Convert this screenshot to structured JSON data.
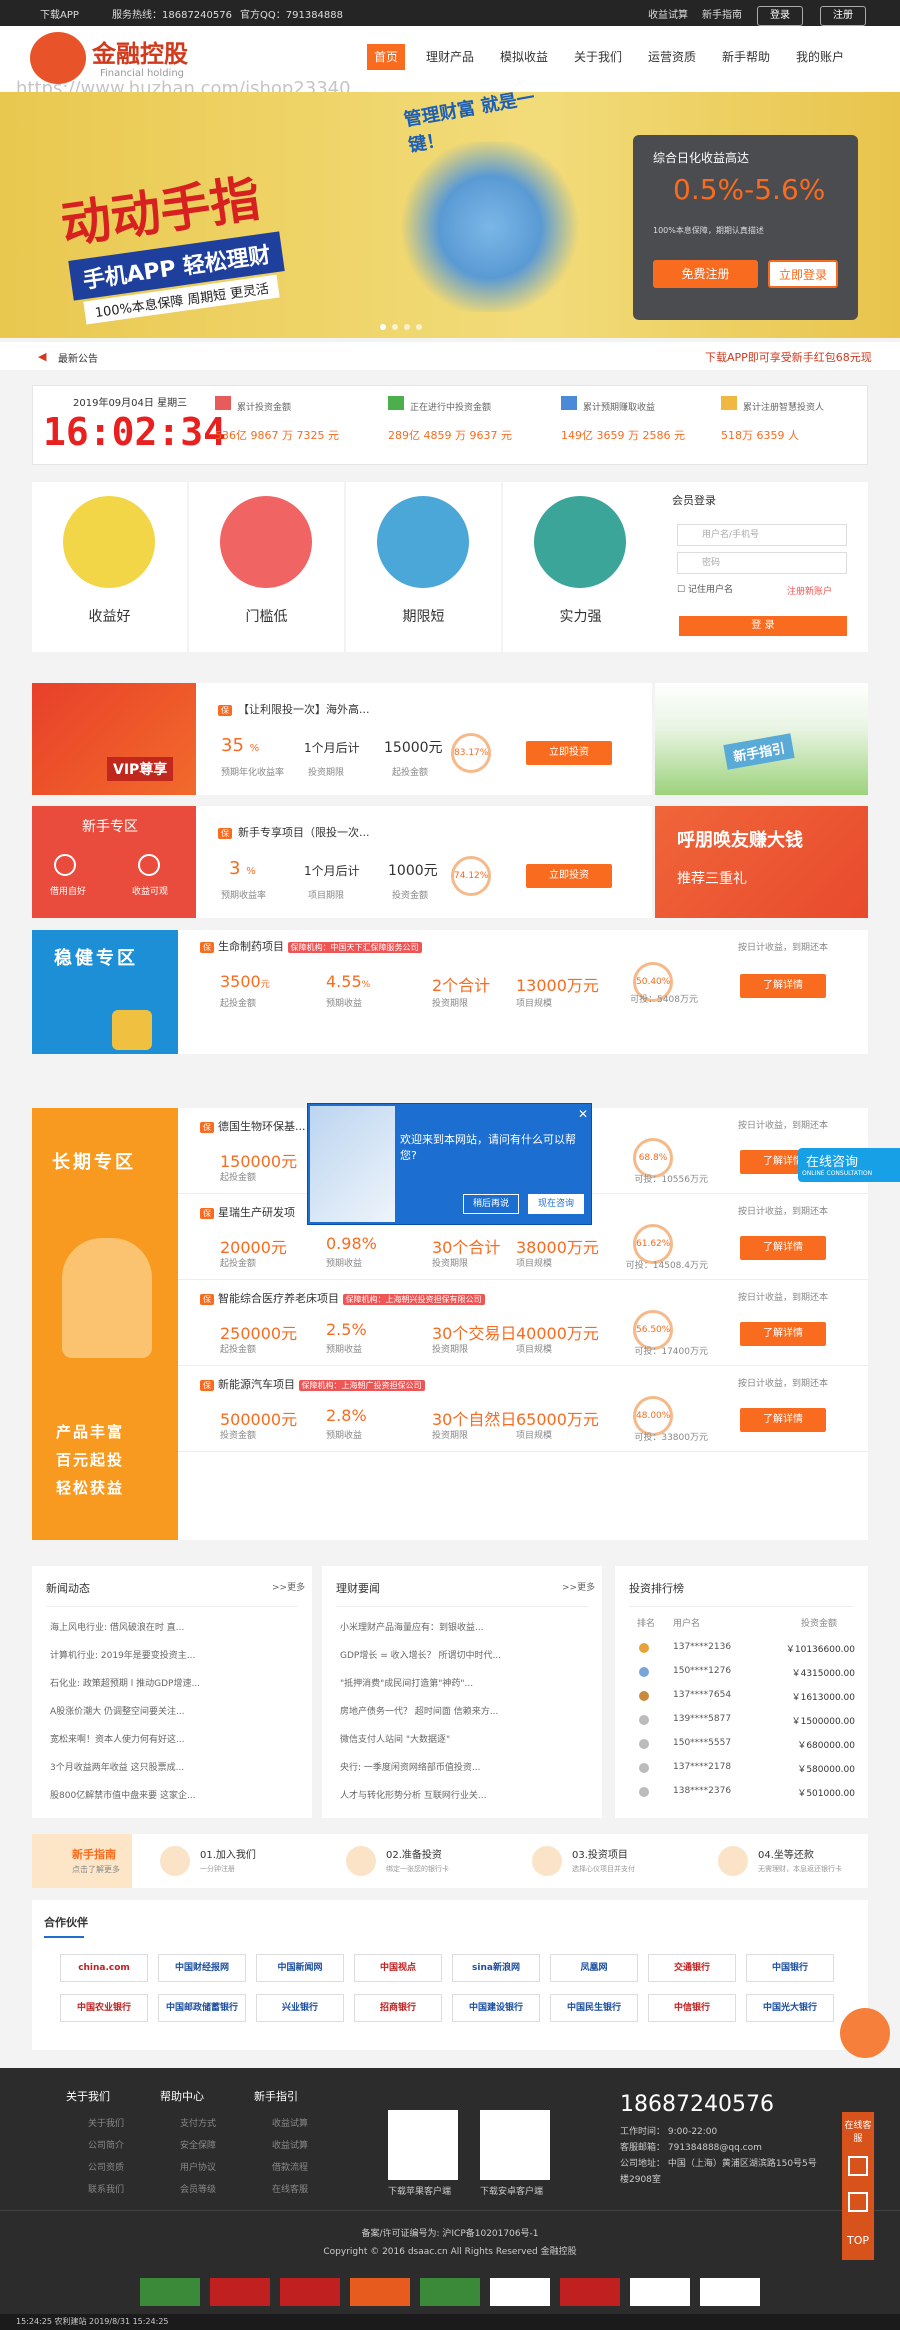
{
  "topbar": {
    "app": "下载APP",
    "hotline": "服务热线：18687240576",
    "qq": "官方QQ：791384888",
    "calc": "收益试算",
    "guide": "新手指南",
    "login": "登录",
    "register": "注册"
  },
  "header": {
    "logo": "金融控股",
    "logo_sub": "Financial holding",
    "watermark": "https://www.huzhan.com/ishop23340"
  },
  "nav": [
    "首页",
    "理财产品",
    "模拟收益",
    "关于我们",
    "运营资质",
    "新手帮助",
    "我的账户"
  ],
  "banner": {
    "main": "动动手指",
    "sub": "手机APP 轻松理财",
    "tags": "100%本息保障  周期短  更灵活",
    "bubble": "管理财富 就是一键！",
    "panel_title": "综合日化收益高达",
    "panel_rate": "0.5%-5.6%",
    "panel_note": "100%本息保障，期期认真描述",
    "btn_reg": "免费注册",
    "btn_login": "立即登录"
  },
  "notice": {
    "label": "最新公告",
    "promo": "下载APP即可享受新手红包68元现"
  },
  "stats": {
    "date": "2019年09月04日 星期三",
    "time": "16:02:34",
    "items": [
      {
        "label": "累计投资金额",
        "val": "536亿 9867 万 7325 元"
      },
      {
        "label": "正在进行中投资金额",
        "val": "289亿 4859 万 9637 元"
      },
      {
        "label": "累计预期赚取收益",
        "val": "149亿 3659 万 2586 元"
      },
      {
        "label": "累计注册智慧投资人",
        "val": "518万 6359 人"
      }
    ]
  },
  "features": [
    "收益好",
    "门槛低",
    "期限短",
    "实力强"
  ],
  "login": {
    "title": "会员登录",
    "user": "用户名/手机号",
    "pwd": "密码",
    "remember": "记住用户名",
    "forgot": "注册新账户",
    "submit": "登 录"
  },
  "vip": {
    "title": "【让利限投一次】海外高...",
    "rate": "35",
    "rate_unit": "%",
    "rate_lbl": "预期年化收益率",
    "term": "1个月后计",
    "term_lbl": "投资期限",
    "amt": "15000元",
    "amt_lbl": "起投金额",
    "pct": "83.17%",
    "btn": "立即投资",
    "label": "VIP尊享"
  },
  "newbie": {
    "title": "新手专享项目（限投一次...",
    "rate": "3",
    "rate_unit": "%",
    "rate_lbl": "预期收益率",
    "term": "1个月后计",
    "term_lbl": "项目期限",
    "amt": "1000元",
    "amt_lbl": "投资金额",
    "pct": "74.12%",
    "btn": "立即投资",
    "zone": "新手专区",
    "i1": "借用自好",
    "i2": "收益可观",
    "side_top": "新手指引",
    "side2_a": "呼朋唤友赚大钱",
    "side2_b": "推荐三重礼"
  },
  "steady": {
    "zone": "稳健专区",
    "name": "生命制药项目",
    "tag": "保障机构：中国天下汇保障服务公司",
    "rate": "3500",
    "rate_unit": "元",
    "rate_lbl": "起投金额",
    "r2": "4.55",
    "r2_unit": "%",
    "r2_lbl": "预期收益",
    "term": "2个合计",
    "term_lbl": "投资期限",
    "amt": "13000万元",
    "amt_lbl": "项目规模",
    "pct": "50.40%",
    "avail": "可投：5408万元",
    "right": "按日计收益，到期还本",
    "btn": "了解详情"
  },
  "long": {
    "zone": "长期专区",
    "slogan": [
      "产品丰富",
      "百元起投",
      "轻松获益"
    ],
    "rows": [
      {
        "name": "德国生物环保基...",
        "v1": "150000元",
        "l1": "起投金额",
        "v2": "",
        "l2": "",
        "v3": "",
        "l3": "",
        "v4": "",
        "l4": "",
        "pct": "68.8%",
        "avail": "可投：10556万元",
        "right": "按日计收益，到期还本",
        "btn": "了解详情"
      },
      {
        "name": "星瑞生产研发项",
        "v1": "20000元",
        "l1": "起投金额",
        "v2": "0.98%",
        "l2": "预期收益",
        "v3": "30个合计",
        "l3": "投资期限",
        "v4": "38000万元",
        "l4": "项目规模",
        "pct": "61.62%",
        "avail": "可投：14508.4万元",
        "right": "按日计收益，到期还本",
        "btn": "了解详情"
      },
      {
        "name": "智能综合医疗养老床项目",
        "tag": "保障机构：上海朝兴投资担保有限公司",
        "v1": "250000元",
        "l1": "起投金额",
        "v2": "2.5%",
        "l2": "预期收益",
        "v3": "30个交易日",
        "l3": "投资期限",
        "v4": "40000万元",
        "l4": "项目规模",
        "pct": "56.50%",
        "avail": "可投：17400万元",
        "right": "按日计收益，到期还本",
        "btn": "了解详情"
      },
      {
        "name": "新能源汽车项目",
        "tag": "保障机构：上海朝广投资担保公司",
        "v1": "500000元",
        "l1": "投资金额",
        "v2": "2.8%",
        "l2": "预期收益",
        "v3": "30个自然日",
        "l3": "投资期限",
        "v4": "65000万元",
        "l4": "项目规模",
        "pct": "48.00%",
        "avail": "可投：33800万元",
        "right": "按日计收益，到期还本",
        "btn": "了解详情"
      }
    ]
  },
  "popup": {
    "text": "欢迎来到本网站，请问有什么可以帮您?",
    "b1": "稍后再说",
    "b2": "现在咨询"
  },
  "consult": {
    "t": "在线咨询",
    "s": "ONLINE CONSULTATION"
  },
  "news": {
    "title": "新闻动态",
    "more": ">>更多",
    "items": [
      "海上风电行业: 借风破浪在时 直...",
      "计算机行业: 2019年是要变投资主...",
      "石化业: 政策超预期 l 推动GDP增速...",
      "A股涨价潮大 仍调整空间要关注...",
      "宽松来啊！资本人使力何有好这...",
      "3个月收益两年收益 这只股票成...",
      "股800亿解禁市值中盘来要 这家企..."
    ]
  },
  "mgmt": {
    "title": "理财要闻",
    "more": ">>更多",
    "items": [
      "小米理财产品海量应有：到银收益...",
      "GDP增长 = 收入增长？ 所谓切中时代...",
      "\"抵押消费\"成民间打造第\"神药\"...",
      "房地产债务一代？ 超时间面 信赖来方...",
      "微信支付人站间 \"大数据逐\"",
      "央行: 一季度闲资网络部币值投资...",
      "人才与转化形势分析 互联网行业关..."
    ]
  },
  "rank": {
    "title": "投资排行榜",
    "h1": "排名",
    "h2": "用户名",
    "h3": "投资金额",
    "rows": [
      {
        "u": "137****2136",
        "a": "￥10136600.00"
      },
      {
        "u": "150****1276",
        "a": "￥4315000.00"
      },
      {
        "u": "137****7654",
        "a": "￥1613000.00"
      },
      {
        "u": "139****5877",
        "a": "￥1500000.00"
      },
      {
        "u": "150****5557",
        "a": "￥680000.00"
      },
      {
        "u": "137****2178",
        "a": "￥580000.00"
      },
      {
        "u": "138****2376",
        "a": "￥501000.00"
      }
    ]
  },
  "steps": {
    "title": "新手指南",
    "sub": "点击了解更多",
    "items": [
      {
        "t": "01.加入我们",
        "s": "一分钟注册"
      },
      {
        "t": "02.准备投资",
        "s": "绑定一张您的银行卡"
      },
      {
        "t": "03.投资项目",
        "s": "选择心仪项目并支付"
      },
      {
        "t": "04.坐等还款",
        "s": "无需理财，本息返还银行卡"
      }
    ]
  },
  "partners": {
    "title": "合作伙伴",
    "row1": [
      "china.com",
      "中国财经报网",
      "中国新闻网",
      "中国视点",
      "sina新浪网",
      "凤凰网",
      "交通银行",
      "中国银行"
    ],
    "row2": [
      "中国农业银行",
      "中国邮政储蓄银行",
      "兴业银行",
      "招商银行",
      "中国建设银行",
      "中国民生银行",
      "中信银行",
      "中国光大银行"
    ]
  },
  "footer": {
    "c1": "关于我们",
    "c2": "帮助中心",
    "c3": "新手指引",
    "l1": [
      "关于我们",
      "公司简介",
      "公司资质",
      "联系我们"
    ],
    "l2": [
      "支付方式",
      "安全保障",
      "用户协议",
      "会员等级"
    ],
    "l3": [
      "收益试算",
      "收益试算",
      "借款流程",
      "在线客服"
    ],
    "qr1": "下载苹果客户端",
    "qr2": "下载安卓客户端",
    "phone": "18687240576",
    "work": "工作时间： 9:00-22:00",
    "email": "客服邮箱： 791384888@qq.com",
    "addr": "公司地址： 中国（上海）黄浦区湖滨路150号5号楼2908室",
    "icp": "备案/许可证编号为: 沪ICP备10201706号-1",
    "copy": "Copyright © 2016 dsaac.cn All Rights Reserved 金融控股",
    "status": "15:24:25 农利建站 2019/8/31 15:24:25"
  },
  "side": {
    "a": "在线客服",
    "b": "TOP"
  }
}
